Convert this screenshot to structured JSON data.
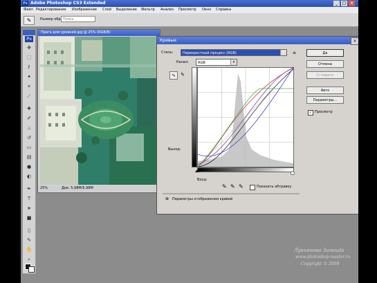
{
  "app": {
    "title": "Adobe Photoshop CS3 Extended",
    "logo": "Ps",
    "window_buttons": [
      "_",
      "□",
      "×"
    ]
  },
  "menu": [
    "Файл",
    "Редактирование",
    "Изображение",
    "Слой",
    "Выделение",
    "Фильтр",
    "Анализ",
    "Просмотр",
    "Окно",
    "Справка"
  ],
  "options": {
    "sample_label": "Размер образца:",
    "sample_value": "Точка"
  },
  "toolbox": {
    "logo": "Ps",
    "tools": [
      "move-tool",
      "marquee-tool",
      "lasso-tool",
      "magic-wand-tool",
      "crop-tool",
      "slice-tool",
      "healing-brush-tool",
      "brush-tool",
      "clone-stamp-tool",
      "history-brush-tool",
      "eraser-tool",
      "gradient-tool",
      "blur-tool",
      "dodge-tool",
      "pen-tool",
      "type-tool",
      "path-selection-tool",
      "shape-tool",
      "notes-tool",
      "eyedropper-tool",
      "hand-tool",
      "zoom-tool"
    ]
  },
  "document": {
    "title": "Прага дом уровней.jpg @ 25% (RGB/8)",
    "zoom": "25%",
    "doc_size": "Док: 5,98M/5,98M"
  },
  "curves_dialog": {
    "title": "Кривые",
    "preset_label": "Стиль:",
    "preset_value": "Перекрестный процесс (RGB)",
    "channel_label": "Канал:",
    "channel_value": "RGB",
    "output_label": "Выход:",
    "input_label": "Вход:",
    "show_clipping_label": "Показать обтравку",
    "display_options_label": "Параметры отображения кривой",
    "preview_label": "Просмотр",
    "preview_checked": true,
    "buttons": {
      "ok": "Да",
      "cancel": "Отмена",
      "smooth": "Сгладить",
      "auto": "Авто",
      "options": "Параметры..."
    },
    "curve_colors": {
      "rgb": "#222222",
      "red": "#c04040",
      "green": "#50b050",
      "blue": "#4040c0",
      "violet": "#8050a0"
    }
  },
  "signature": {
    "line1": "Лукьянова Зинаида",
    "line2": "www.photoshop-master.ru",
    "line3": "Copyright © 2008"
  }
}
